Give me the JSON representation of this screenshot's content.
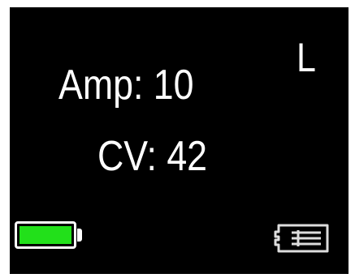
{
  "display": {
    "amp_label": "Amp: 10",
    "cv_label": "CV: 42",
    "channel": "L"
  },
  "status": {
    "battery_icon": "battery-icon",
    "battery_level": 1.0,
    "battery_color": "#22e01a",
    "card_icon": "memory-card-icon"
  }
}
